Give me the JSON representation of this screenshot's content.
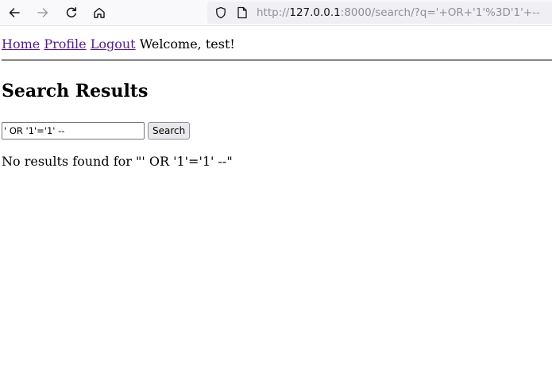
{
  "browser": {
    "url_prefix": "http://",
    "url_host": "127.0.0.1",
    "url_rest": ":8000/search/?q='+OR+'1'%3D'1'+--"
  },
  "nav": {
    "links": [
      "Home",
      "Profile",
      "Logout"
    ],
    "welcome": "Welcome, test!"
  },
  "page": {
    "heading": "Search Results"
  },
  "search": {
    "query_value": "' OR '1'='1' --",
    "button_label": "Search"
  },
  "results": {
    "message": "No results found for \"' OR '1'='1' --\""
  }
}
